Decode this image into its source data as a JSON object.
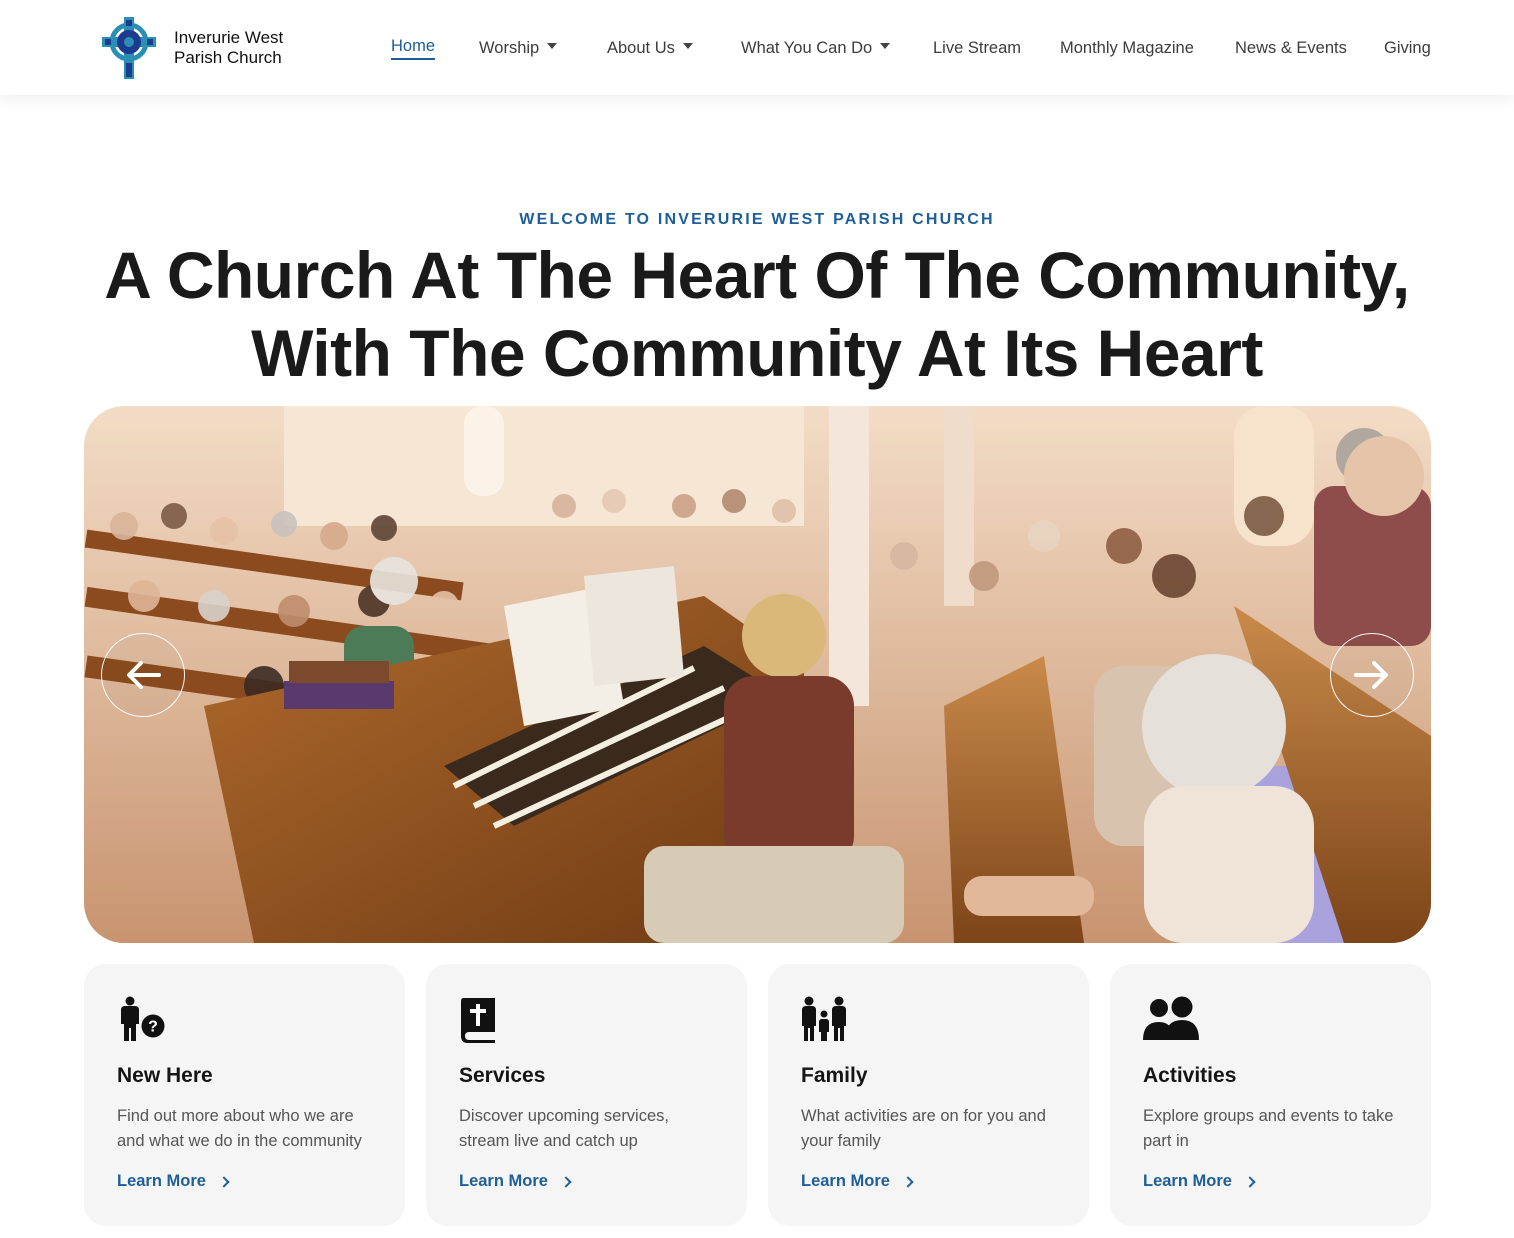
{
  "header": {
    "logo_line1": "Inverurie West",
    "logo_line2": "Parish Church",
    "nav": [
      {
        "label": "Home",
        "active": true,
        "dropdown": false
      },
      {
        "label": "Worship",
        "active": false,
        "dropdown": true
      },
      {
        "label": "About Us",
        "active": false,
        "dropdown": true
      },
      {
        "label": "What You Can Do",
        "active": false,
        "dropdown": true
      },
      {
        "label": "Live Stream",
        "active": false,
        "dropdown": false
      },
      {
        "label": "Monthly Magazine",
        "active": false,
        "dropdown": false
      },
      {
        "label": "News & Events",
        "active": false,
        "dropdown": false
      },
      {
        "label": "Giving",
        "active": false,
        "dropdown": false
      }
    ]
  },
  "hero": {
    "eyebrow": "WELCOME TO INVERURIE WEST PARISH CHURCH",
    "headline_line1": "A Church At The Heart Of The Community,",
    "headline_line2": "With The Community At Its Heart",
    "prev_icon": "arrow-left-icon",
    "next_icon": "arrow-right-icon"
  },
  "cards": [
    {
      "icon": "person-question-icon",
      "title": "New Here",
      "description": "Find out more about who we are and what we do in the community",
      "link": "Learn More"
    },
    {
      "icon": "bible-icon",
      "title": "Services",
      "description": "Discover upcoming services, stream live and catch up",
      "link": "Learn More"
    },
    {
      "icon": "family-icon",
      "title": "Family",
      "description": "What activities are on for you and your family",
      "link": "Learn More"
    },
    {
      "icon": "users-icon",
      "title": "Activities",
      "description": "Explore groups and events to take part in",
      "link": "Learn More"
    }
  ],
  "colors": {
    "accent": "#1e5f99",
    "card_bg": "#f5f5f6",
    "headline": "#1a1a1a"
  }
}
